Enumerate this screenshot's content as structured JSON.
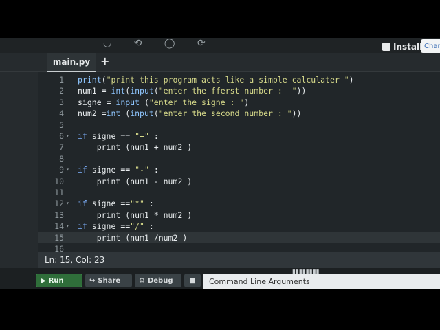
{
  "topbar": {
    "install_label": "Install",
    "change_label": "Chan"
  },
  "tabs": [
    {
      "label": "main.py"
    }
  ],
  "add_tab_symbol": "+",
  "editor": {
    "lines": [
      {
        "num": "1",
        "fold": "",
        "parts": [
          [
            "fn",
            "print"
          ],
          [
            "p",
            "("
          ],
          [
            "str",
            "\"print this program acts like a simple calculater \""
          ],
          [
            "p",
            ")"
          ]
        ]
      },
      {
        "num": "2",
        "fold": "",
        "parts": [
          [
            "p",
            "num1 = "
          ],
          [
            "fn",
            "int"
          ],
          [
            "p",
            "("
          ],
          [
            "fn",
            "input"
          ],
          [
            "p",
            "("
          ],
          [
            "str",
            "\"enter the fferst number :  \""
          ],
          [
            "p",
            "))"
          ]
        ]
      },
      {
        "num": "3",
        "fold": "",
        "parts": [
          [
            "p",
            "signe = "
          ],
          [
            "fn",
            "input"
          ],
          [
            "p",
            " ("
          ],
          [
            "str",
            "\"enter the signe : \""
          ],
          [
            "p",
            ")"
          ]
        ]
      },
      {
        "num": "4",
        "fold": "",
        "parts": [
          [
            "p",
            "num2 ="
          ],
          [
            "fn",
            "int"
          ],
          [
            "p",
            " ("
          ],
          [
            "fn",
            "input"
          ],
          [
            "p",
            "("
          ],
          [
            "str",
            "\"enter the second number : \""
          ],
          [
            "p",
            "))"
          ]
        ]
      },
      {
        "num": "5",
        "fold": "",
        "parts": []
      },
      {
        "num": "6",
        "fold": "▾",
        "parts": [
          [
            "kw",
            "if"
          ],
          [
            "p",
            " signe == "
          ],
          [
            "str",
            "\"+\""
          ],
          [
            "p",
            " :"
          ]
        ]
      },
      {
        "num": "7",
        "fold": "",
        "parts": [
          [
            "p",
            "    print (num1 + num2 )"
          ]
        ]
      },
      {
        "num": "8",
        "fold": "",
        "parts": []
      },
      {
        "num": "9",
        "fold": "▾",
        "parts": [
          [
            "kw",
            "if"
          ],
          [
            "p",
            " signe == "
          ],
          [
            "str",
            "\"-\""
          ],
          [
            "p",
            " :"
          ]
        ]
      },
      {
        "num": "10",
        "fold": "",
        "parts": [
          [
            "p",
            "    print (num1 - num2 )"
          ]
        ]
      },
      {
        "num": "11",
        "fold": "",
        "parts": []
      },
      {
        "num": "12",
        "fold": "▾",
        "parts": [
          [
            "kw",
            "if"
          ],
          [
            "p",
            " signe =="
          ],
          [
            "str",
            "\"*\""
          ],
          [
            "p",
            " :"
          ]
        ]
      },
      {
        "num": "13",
        "fold": "",
        "parts": [
          [
            "p",
            "    print (num1 * num2 )"
          ]
        ]
      },
      {
        "num": "14",
        "fold": "▾",
        "parts": [
          [
            "kw",
            "if"
          ],
          [
            "p",
            " signe =="
          ],
          [
            "str",
            "\"/\""
          ],
          [
            "p",
            " :"
          ]
        ]
      },
      {
        "num": "15",
        "fold": "",
        "parts": [
          [
            "p",
            "    print (num1 /num2 )"
          ]
        ]
      },
      {
        "num": "16",
        "fold": "",
        "parts": []
      }
    ],
    "active_line": "15"
  },
  "status": {
    "position_text": "Ln: 15,  Col: 23"
  },
  "bottom": {
    "run_label": "Run",
    "share_label": "Share",
    "debug_label": "Debug",
    "stop_label": "■",
    "cmdline_label": "Command Line Arguments",
    "resize_dots": "▮▮▮▮▮▮▮▮"
  }
}
